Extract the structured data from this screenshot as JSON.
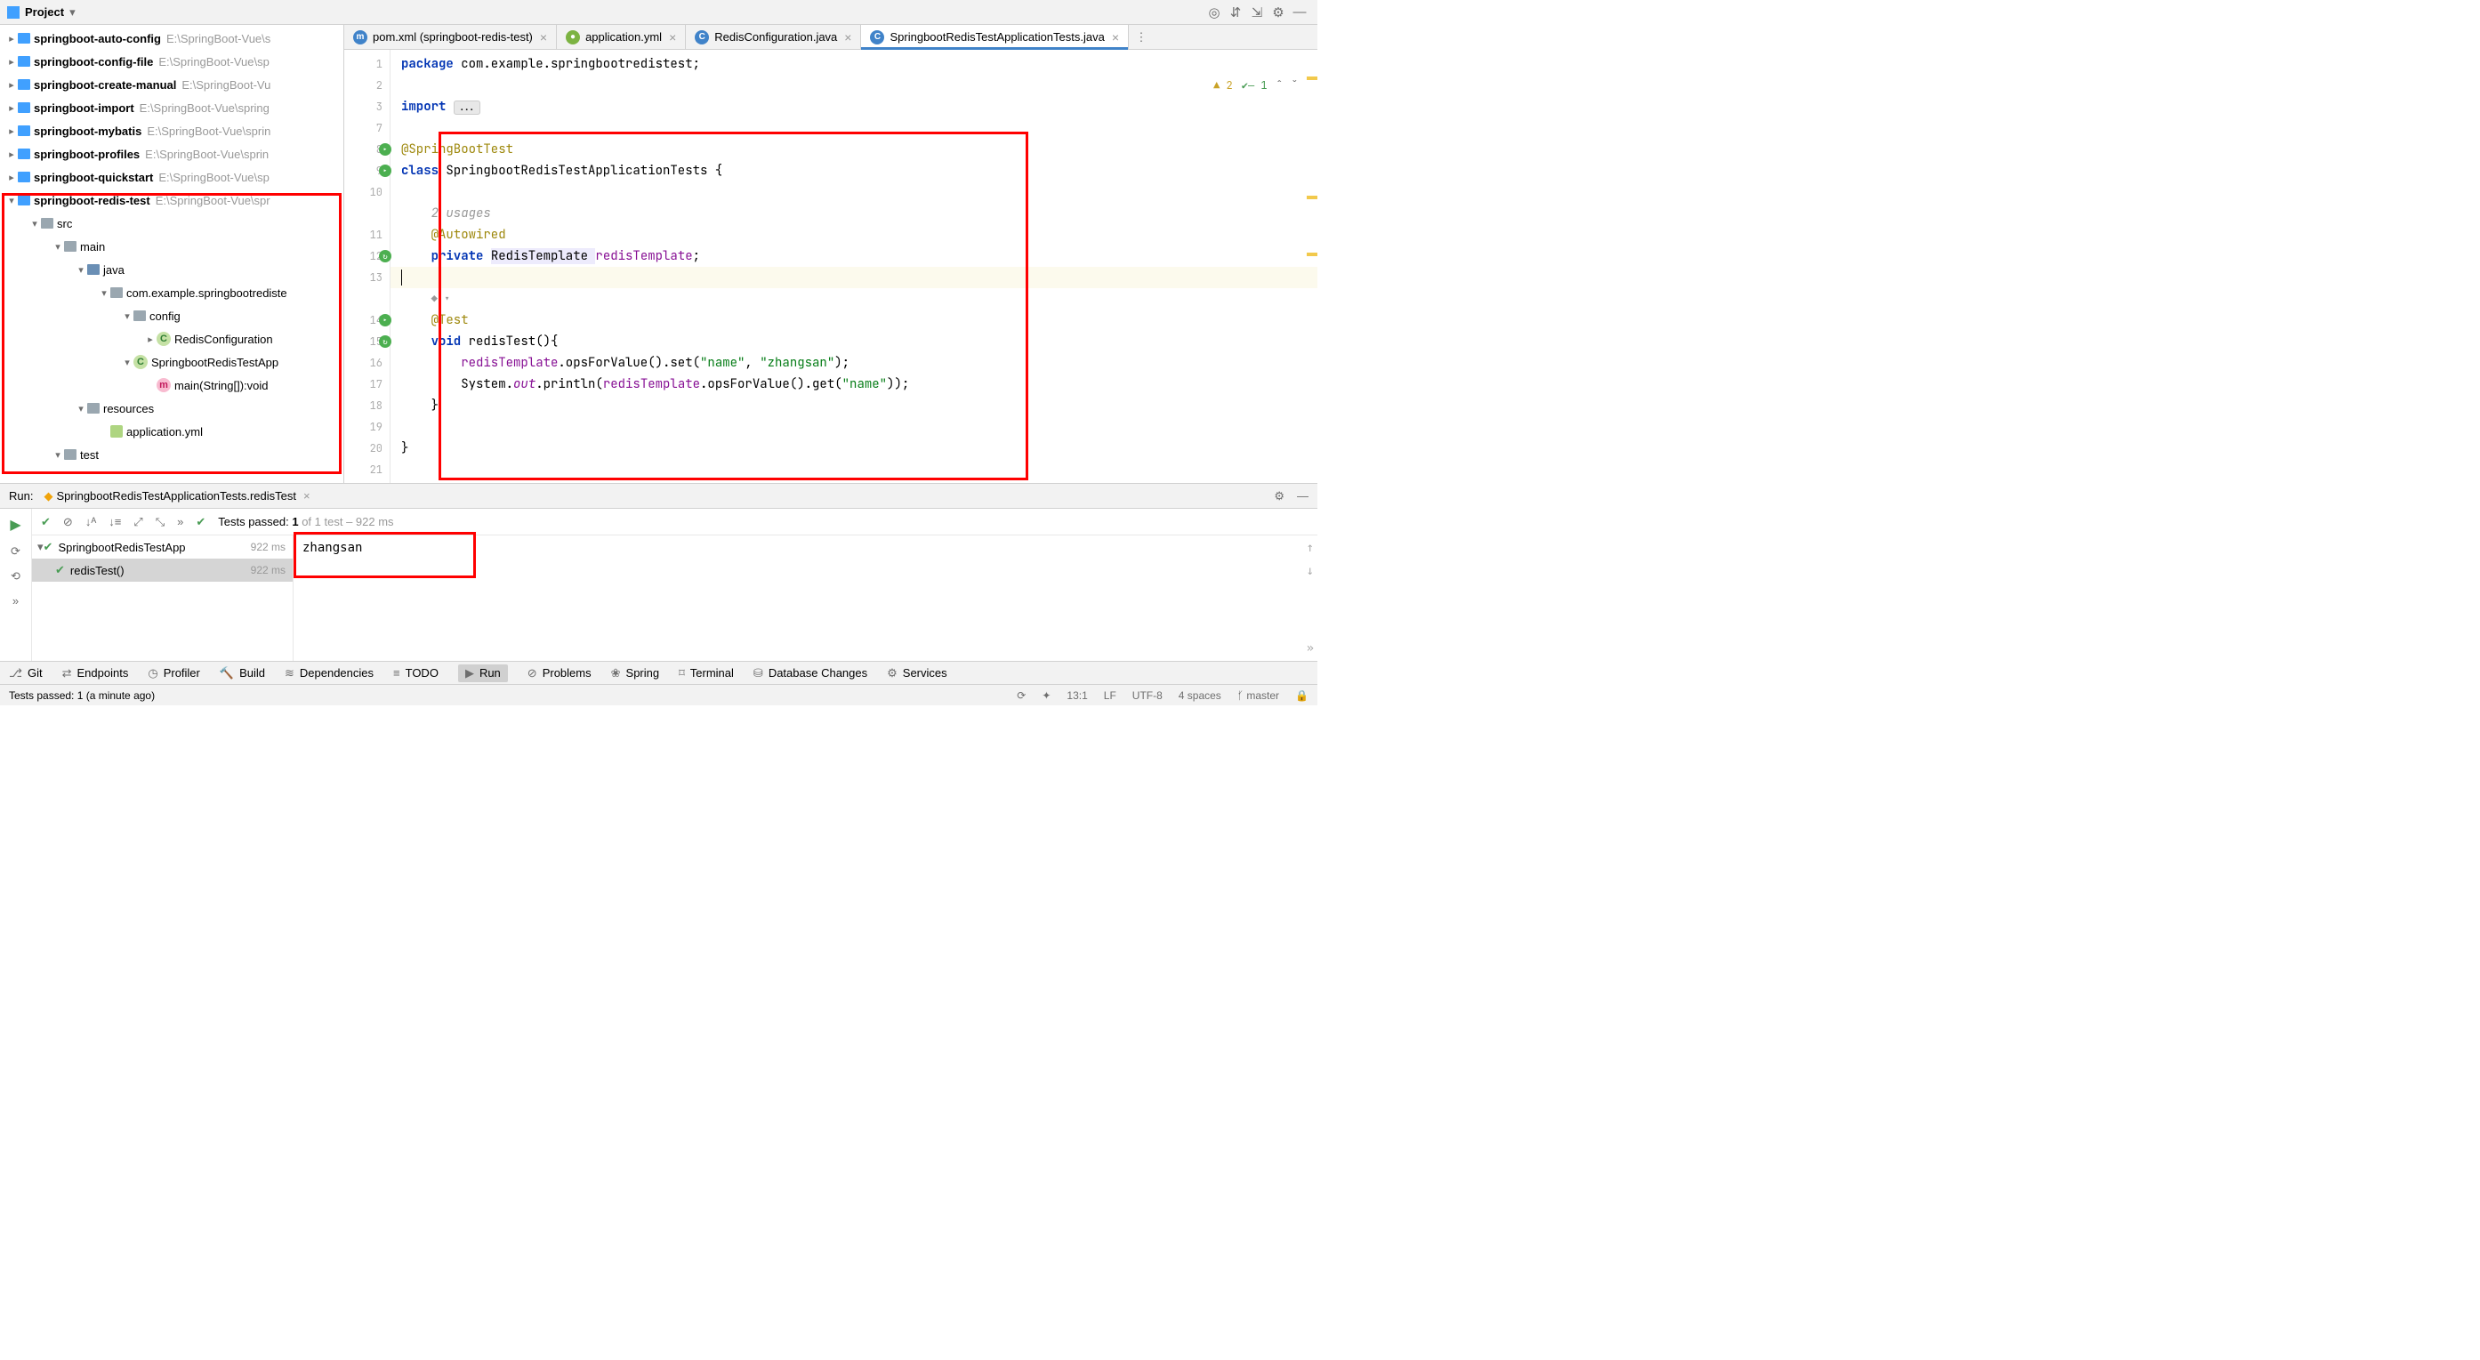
{
  "sidebar": {
    "title": "Project",
    "items": [
      {
        "name": "springboot-auto-config",
        "path": "E:\\SpringBoot-Vue\\s",
        "depth": 0,
        "bold": true,
        "expander": "▸",
        "icon": "folder-blue"
      },
      {
        "name": "springboot-config-file",
        "path": "E:\\SpringBoot-Vue\\sp",
        "depth": 0,
        "bold": true,
        "expander": "▸",
        "icon": "folder-blue"
      },
      {
        "name": "springboot-create-manual",
        "path": "E:\\SpringBoot-Vu",
        "depth": 0,
        "bold": true,
        "expander": "▸",
        "icon": "folder-blue"
      },
      {
        "name": "springboot-import",
        "path": "E:\\SpringBoot-Vue\\spring",
        "depth": 0,
        "bold": true,
        "expander": "▸",
        "icon": "folder-blue"
      },
      {
        "name": "springboot-mybatis",
        "path": "E:\\SpringBoot-Vue\\sprin",
        "depth": 0,
        "bold": true,
        "expander": "▸",
        "icon": "folder-blue"
      },
      {
        "name": "springboot-profiles",
        "path": "E:\\SpringBoot-Vue\\sprin",
        "depth": 0,
        "bold": true,
        "expander": "▸",
        "icon": "folder-blue"
      },
      {
        "name": "springboot-quickstart",
        "path": "E:\\SpringBoot-Vue\\sp",
        "depth": 0,
        "bold": true,
        "expander": "▸",
        "icon": "folder-blue"
      },
      {
        "name": "springboot-redis-test",
        "path": "E:\\SpringBoot-Vue\\spr",
        "depth": 0,
        "bold": true,
        "expander": "▾",
        "icon": "folder-blue"
      },
      {
        "name": "src",
        "path": "",
        "depth": 1,
        "bold": false,
        "expander": "▾",
        "icon": "folder"
      },
      {
        "name": "main",
        "path": "",
        "depth": 2,
        "bold": false,
        "expander": "▾",
        "icon": "folder"
      },
      {
        "name": "java",
        "path": "",
        "depth": 3,
        "bold": false,
        "expander": "▾",
        "icon": "folder-src"
      },
      {
        "name": "com.example.springbootrediste",
        "path": "",
        "depth": 4,
        "bold": false,
        "expander": "▾",
        "icon": "folder"
      },
      {
        "name": "config",
        "path": "",
        "depth": 5,
        "bold": false,
        "expander": "▾",
        "icon": "folder"
      },
      {
        "name": "RedisConfiguration",
        "path": "",
        "depth": 6,
        "bold": false,
        "expander": "▸",
        "icon": "class"
      },
      {
        "name": "SpringbootRedisTestApp",
        "path": "",
        "depth": 5,
        "bold": false,
        "expander": "▾",
        "icon": "class-run"
      },
      {
        "name": "main(String[]):void",
        "path": "",
        "depth": 6,
        "bold": false,
        "expander": "",
        "icon": "method"
      },
      {
        "name": "resources",
        "path": "",
        "depth": 3,
        "bold": false,
        "expander": "▾",
        "icon": "folder"
      },
      {
        "name": "application.yml",
        "path": "",
        "depth": 4,
        "bold": false,
        "expander": "",
        "icon": "yml"
      },
      {
        "name": "test",
        "path": "",
        "depth": 2,
        "bold": false,
        "expander": "▾",
        "icon": "folder"
      }
    ]
  },
  "tabs": [
    {
      "label": "pom.xml (springboot-redis-test)",
      "icon": "m",
      "color": "#4083c9",
      "active": false
    },
    {
      "label": "application.yml",
      "icon": "●",
      "color": "#7cb342",
      "active": false
    },
    {
      "label": "RedisConfiguration.java",
      "icon": "C",
      "color": "#4083c9",
      "active": false
    },
    {
      "label": "SpringbootRedisTestApplicationTests.java",
      "icon": "C",
      "color": "#4083c9",
      "active": true
    }
  ],
  "inspection": {
    "warnings": "2",
    "weak": "1"
  },
  "code": {
    "l1_pkg": "package ",
    "l1_rest": "com.example.springbootredistest;",
    "l3_imp": "import ",
    "l3_fold": "...",
    "l8_ann": "@SpringBootTest",
    "l9_kw": "class ",
    "l9_name": "SpringbootRedisTestApplicationTests {",
    "l_usages": "2 usages",
    "l11_ann": "@Autowired",
    "l12_kw": "private ",
    "l12_type": "RedisTemplate ",
    "l12_field": "redisTemplate",
    "l12_end": ";",
    "l14_ann": "@Test",
    "l15_kw": "void ",
    "l15_name": "redisTest(){",
    "l16_a": "redisTemplate",
    "l16_b": ".opsForValue().set(",
    "l16_s1": "\"name\"",
    "l16_c": ", ",
    "l16_s2": "\"zhangsan\"",
    "l16_d": ");",
    "l17_a": "System.",
    "l17_out": "out",
    "l17_b": ".println(",
    "l17_c": "redisTemplate",
    "l17_d": ".opsForValue().get(",
    "l17_s": "\"name\"",
    "l17_e": "));",
    "l18": "    }",
    "l20": "}"
  },
  "gutter_lines": [
    "1",
    "2",
    "3",
    "7",
    "8",
    "9",
    "10",
    "11",
    "12",
    "13",
    "14",
    "15",
    "16",
    "17",
    "18",
    "19",
    "20",
    "21"
  ],
  "run": {
    "label": "Run:",
    "config": "SpringbootRedisTestApplicationTests.redisTest",
    "passed_prefix": "Tests passed: ",
    "passed_count": "1",
    "passed_suffix": " of 1 test",
    "passed_time": " – 922 ms",
    "tree": [
      {
        "name": "SpringbootRedisTestApp",
        "time": "922 ms",
        "depth": 0,
        "sel": false
      },
      {
        "name": "redisTest()",
        "time": "922 ms",
        "depth": 1,
        "sel": true
      }
    ],
    "output": "zhangsan"
  },
  "toolstrip": [
    {
      "label": "Git",
      "active": false
    },
    {
      "label": "Endpoints",
      "active": false
    },
    {
      "label": "Profiler",
      "active": false
    },
    {
      "label": "Build",
      "active": false
    },
    {
      "label": "Dependencies",
      "active": false
    },
    {
      "label": "TODO",
      "active": false
    },
    {
      "label": "Run",
      "active": true
    },
    {
      "label": "Problems",
      "active": false
    },
    {
      "label": "Spring",
      "active": false
    },
    {
      "label": "Terminal",
      "active": false
    },
    {
      "label": "Database Changes",
      "active": false
    },
    {
      "label": "Services",
      "active": false
    }
  ],
  "status": {
    "msg": "Tests passed: 1 (a minute ago)",
    "pos": "13:1",
    "le": "LF",
    "enc": "UTF-8",
    "indent": "4 spaces",
    "branch": "master"
  }
}
